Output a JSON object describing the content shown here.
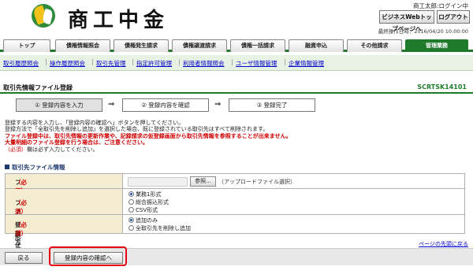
{
  "header": {
    "logo_text": "商工中金",
    "user_name": "商工太郎:ログイン中",
    "top_button": "ビジネスWebトップページへ",
    "logout_button": "ログアウト",
    "last_operation": "最終操作日時：2016/04/20 10:00:00"
  },
  "tabs": [
    "トップ",
    "債権情報照会",
    "債権発生請求",
    "債権譲渡請求",
    "債権一括請求",
    "融資申込",
    "その他請求",
    "管理業務"
  ],
  "subnav": [
    "取引履歴照会",
    "操作履歴照会",
    "取引先管理",
    "指定許可管理",
    "利用者情報照会",
    "ユーザ情報管理",
    "企業情報管理"
  ],
  "page": {
    "title": "取引先情報ファイル登録",
    "screen_id": "SCRTSK14101"
  },
  "steps": [
    "① 登録内容を入力",
    "② 登録内容を確認",
    "③ 登録完了"
  ],
  "step_arrow": "⇒",
  "messages": {
    "line1": "登録する内容を入力し、「登録内容の確認へ」ボタンを押してください。",
    "line2": "登録方法で「全取引先を削除し追加」を選択した場合、既に登録されている取引先はすべて削除されます。",
    "warn1": "ファイル登録中は、取引先情報の更新作業や、記録請求の仮登録画面から取引先情報を参照することが出来ません。",
    "warn2": "大量明細のファイル登録を行う場合は、ご注意ください。",
    "req_mark": "（必須）",
    "req_suffix": "欄は必ず入力してください。"
  },
  "section": {
    "title": "取引先ファイル情報"
  },
  "form": {
    "file_name_label": "ファイル名",
    "file_format_label": "ファイル形式",
    "register_method_label": "登録方法",
    "required": "（必須）",
    "browse_button": "参照...",
    "upload_note": "（アップロードファイル選択）",
    "file_format_options": [
      "業務1形式",
      "総合振込形式",
      "CSV形式"
    ],
    "file_format_selected": 0,
    "register_method_options": [
      "追加のみ",
      "全取引先を削除し追加"
    ],
    "register_method_selected": 0
  },
  "footer": {
    "to_top_link": "ページの先頭に戻る",
    "back_button": "戻る",
    "confirm_button": "登録内容の確認へ"
  },
  "colors": {
    "accent_green": "#1f7a2c",
    "warning_red": "#d00000",
    "label_bg": "#f5edd2",
    "highlight_red": "#e60012"
  }
}
